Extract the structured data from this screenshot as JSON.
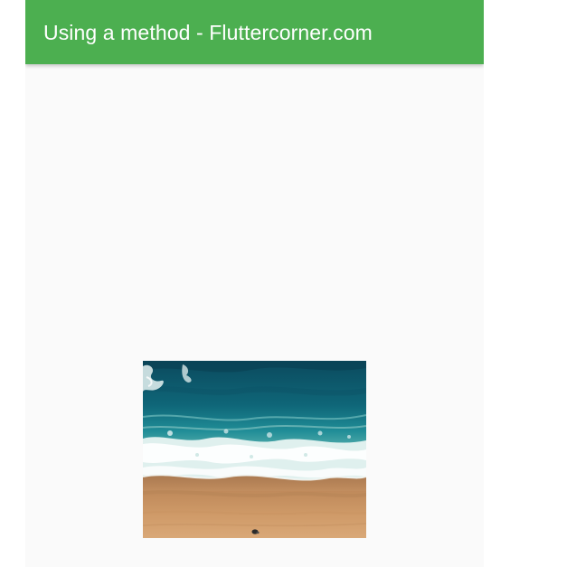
{
  "app_bar": {
    "title": "Using a method - Fluttercorner.com",
    "background_color": "#4caf50",
    "title_color": "#ffffff"
  },
  "body": {
    "background_color": "#fafafa",
    "image": {
      "subject": "beach-aerial-image"
    }
  }
}
